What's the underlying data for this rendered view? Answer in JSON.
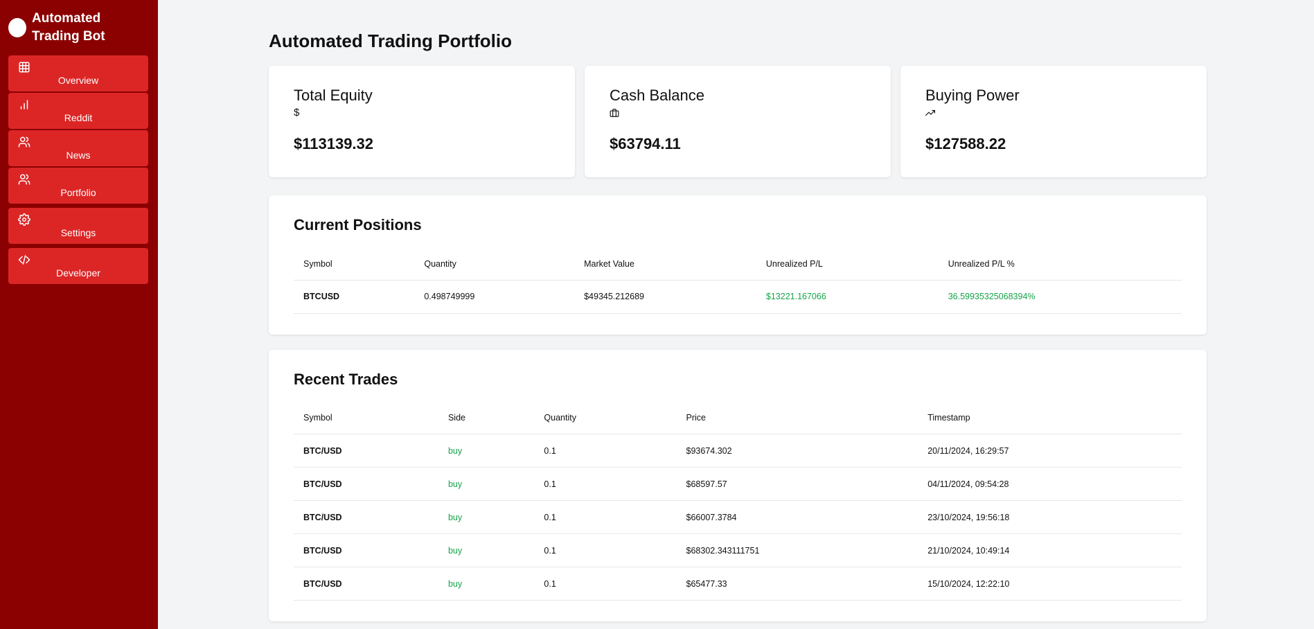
{
  "sidebar": {
    "brand": "Automated Trading Bot",
    "items": [
      {
        "label": "Overview",
        "icon": "grid-icon"
      },
      {
        "label": "Reddit",
        "icon": "bar-chart-icon"
      },
      {
        "label": "News",
        "icon": "users-icon"
      },
      {
        "label": "Portfolio",
        "icon": "users-icon"
      },
      {
        "label": "Settings",
        "icon": "gear-icon"
      },
      {
        "label": "Developer",
        "icon": "code-icon"
      }
    ]
  },
  "page": {
    "title": "Automated Trading Portfolio"
  },
  "stats": [
    {
      "title": "Total Equity",
      "icon": "dollar-icon",
      "icon_glyph": "$",
      "value": "$113139.32"
    },
    {
      "title": "Cash Balance",
      "icon": "briefcase-icon",
      "value": "$63794.11"
    },
    {
      "title": "Buying Power",
      "icon": "trending-up-icon",
      "value": "$127588.22"
    }
  ],
  "positions": {
    "title": "Current Positions",
    "columns": [
      "Symbol",
      "Quantity",
      "Market Value",
      "Unrealized P/L",
      "Unrealized P/L %"
    ],
    "rows": [
      {
        "symbol": "BTCUSD",
        "quantity": "0.498749999",
        "market_value": "$49345.212689",
        "pl": "$13221.167066",
        "pl_pct": "36.59935325068394%"
      }
    ]
  },
  "trades": {
    "title": "Recent Trades",
    "columns": [
      "Symbol",
      "Side",
      "Quantity",
      "Price",
      "Timestamp"
    ],
    "rows": [
      {
        "symbol": "BTC/USD",
        "side": "buy",
        "quantity": "0.1",
        "price": "$93674.302",
        "timestamp": "20/11/2024, 16:29:57"
      },
      {
        "symbol": "BTC/USD",
        "side": "buy",
        "quantity": "0.1",
        "price": "$68597.57",
        "timestamp": "04/11/2024, 09:54:28"
      },
      {
        "symbol": "BTC/USD",
        "side": "buy",
        "quantity": "0.1",
        "price": "$66007.3784",
        "timestamp": "23/10/2024, 19:56:18"
      },
      {
        "symbol": "BTC/USD",
        "side": "buy",
        "quantity": "0.1",
        "price": "$68302.343111751",
        "timestamp": "21/10/2024, 10:49:14"
      },
      {
        "symbol": "BTC/USD",
        "side": "buy",
        "quantity": "0.1",
        "price": "$65477.33",
        "timestamp": "15/10/2024, 12:22:10"
      }
    ]
  },
  "colors": {
    "sidebar_bg": "#8b0000",
    "nav_bg": "#dc2626",
    "positive": "#16a34a"
  }
}
